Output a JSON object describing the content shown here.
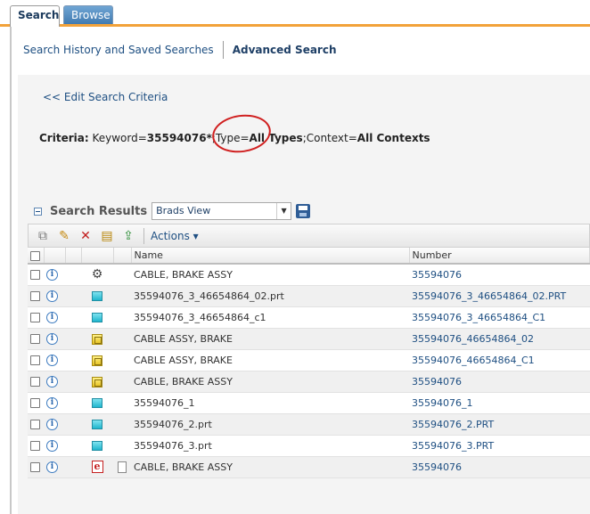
{
  "tabs": [
    {
      "label": "Search",
      "active": true
    },
    {
      "label": "Browse",
      "active": false
    }
  ],
  "subnav": {
    "history_link": "Search History and Saved Searches",
    "advanced_link": "Advanced Search"
  },
  "edit_criteria": "<< Edit Search Criteria",
  "criteria": {
    "label": "Criteria:",
    "keyword_label": "Keyword=",
    "keyword_value": "35594076*",
    "type_label": ";Type=",
    "type_value": "All Types",
    "context_label": ";Context=",
    "context_value": "All Contexts"
  },
  "results": {
    "title": "Search Results",
    "view": "Brads View",
    "actions_label": "Actions",
    "columns": {
      "name": "Name",
      "number": "Number"
    },
    "rows": [
      {
        "type_icon": "gear-icon",
        "doc": false,
        "name": "CABLE, BRAKE ASSY",
        "number": "35594076"
      },
      {
        "type_icon": "part-icon",
        "doc": false,
        "name": "35594076_3_46654864_02.prt",
        "number": "35594076_3_46654864_02.PRT"
      },
      {
        "type_icon": "part-icon",
        "doc": false,
        "name": "35594076_3_46654864_c1",
        "number": "35594076_3_46654864_C1"
      },
      {
        "type_icon": "assembly-icon",
        "doc": false,
        "name": "CABLE ASSY, BRAKE",
        "number": "35594076_46654864_02"
      },
      {
        "type_icon": "assembly-icon",
        "doc": false,
        "name": "CABLE ASSY, BRAKE",
        "number": "35594076_46654864_C1"
      },
      {
        "type_icon": "assembly-icon",
        "doc": false,
        "name": "CABLE, BRAKE ASSY",
        "number": "35594076"
      },
      {
        "type_icon": "part-icon",
        "doc": false,
        "name": "35594076_1",
        "number": "35594076_1"
      },
      {
        "type_icon": "part-icon",
        "doc": false,
        "name": "35594076_2.prt",
        "number": "35594076_2.PRT"
      },
      {
        "type_icon": "part-icon",
        "doc": false,
        "name": "35594076_3.prt",
        "number": "35594076_3.PRT"
      },
      {
        "type_icon": "epm-icon",
        "doc": true,
        "name": "CABLE, BRAKE ASSY",
        "number": "35594076"
      }
    ]
  },
  "colors": {
    "accent_orange": "#f2a23a",
    "link_blue": "#1e4f82",
    "annotation_red": "#d02020"
  }
}
